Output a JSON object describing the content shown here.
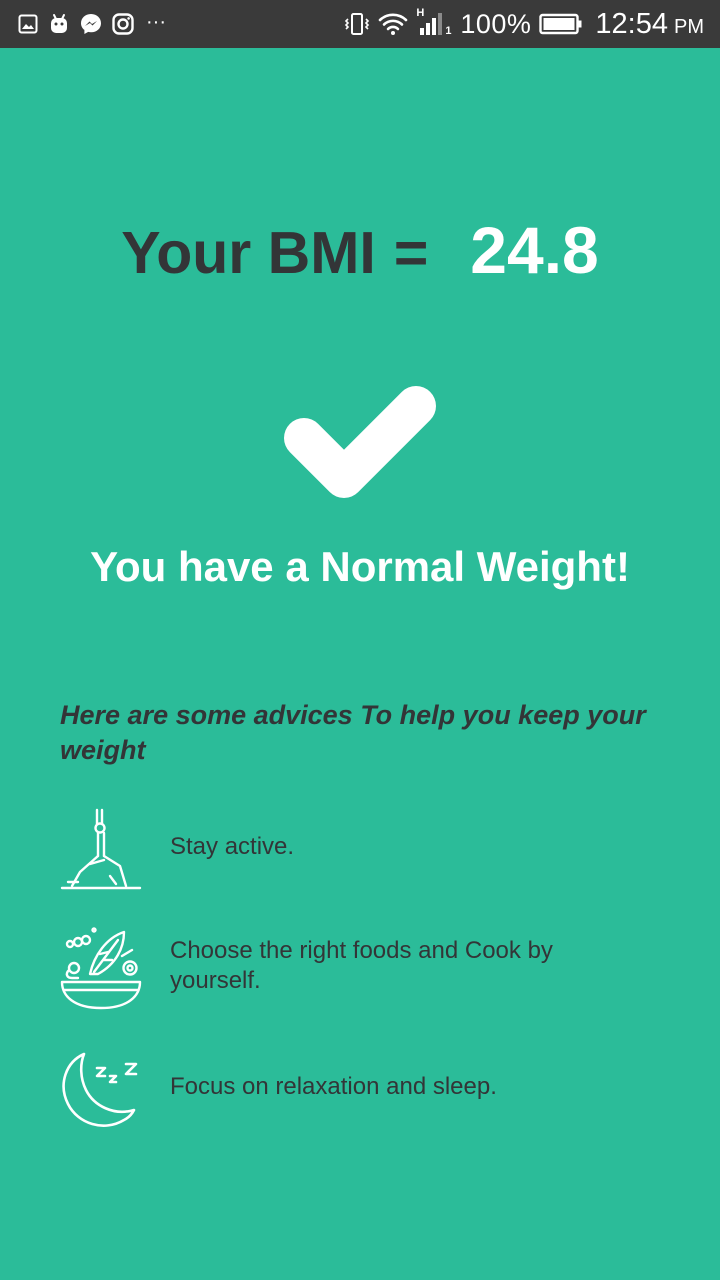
{
  "status_bar": {
    "battery": "100%",
    "time": "12:54",
    "ampm": "PM",
    "network_label": "H",
    "sim_slot": "1",
    "more": "···"
  },
  "bmi": {
    "label": "Your BMI",
    "equals": "=",
    "value": "24.8"
  },
  "result": {
    "icon": "checkmark-icon",
    "text": "You have a Normal Weight!"
  },
  "advice": {
    "title": "Here are some advices To help you keep your weight",
    "items": [
      {
        "icon": "yoga-pose-icon",
        "text": "Stay active."
      },
      {
        "icon": "salad-bowl-icon",
        "text": "Choose the right foods and Cook by yourself."
      },
      {
        "icon": "moon-sleep-icon",
        "text": "Focus on relaxation and sleep."
      }
    ]
  },
  "colors": {
    "background": "#2bbc99",
    "status_bar": "#3a3a3a",
    "dark_text": "#333537",
    "light_text": "#ffffff"
  }
}
